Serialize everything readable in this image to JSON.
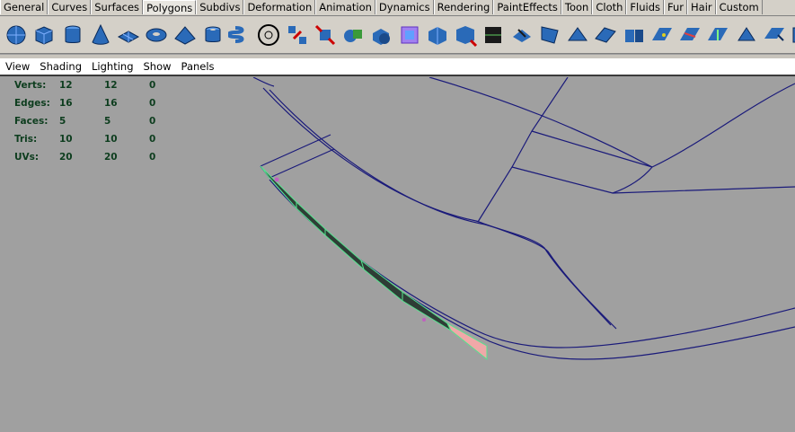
{
  "shelf_tabs": [
    "General",
    "Curves",
    "Surfaces",
    "Polygons",
    "Subdivs",
    "Deformation",
    "Animation",
    "Dynamics",
    "Rendering",
    "PaintEffects",
    "Toon",
    "Cloth",
    "Fluids",
    "Fur",
    "Hair",
    "Custom"
  ],
  "active_tab": "Polygons",
  "shelf_tools": [
    "poly-sphere-icon",
    "poly-cube-icon",
    "poly-cylinder-icon",
    "poly-cone-icon",
    "poly-plane-icon",
    "poly-torus-icon",
    "poly-pyramid-icon",
    "poly-pipe-icon",
    "poly-helix-icon",
    "poly-soccer-ball-icon",
    "separate-icon",
    "combine-icon",
    "boolean-icon",
    "smooth-icon",
    "subdiv-proxy-icon",
    "extrude-face-icon",
    "extrude-edge-icon",
    "split-polygon-icon",
    "bevel-icon",
    "merge-icon",
    "wedge-icon",
    "bridge-icon",
    "append-icon",
    "cut-faces-icon",
    "split-edge-ring-icon",
    "insert-edgeloop-icon",
    "collapse-icon",
    "fill-hole-icon",
    "duplicate-face-icon"
  ],
  "panel_menu": [
    "View",
    "Shading",
    "Lighting",
    "Show",
    "Panels"
  ],
  "hud": {
    "rows": [
      {
        "label": "Verts:",
        "v1": "12",
        "v2": "12",
        "v3": "0"
      },
      {
        "label": "Edges:",
        "v1": "16",
        "v2": "16",
        "v3": "0"
      },
      {
        "label": "Faces:",
        "v1": "5",
        "v2": "5",
        "v3": "0"
      },
      {
        "label": "Tris:",
        "v1": "10",
        "v2": "10",
        "v3": "0"
      },
      {
        "label": "UVs:",
        "v1": "20",
        "v2": "20",
        "v3": "0"
      }
    ]
  },
  "colors": {
    "shelf_bg": "#d4d0c8",
    "viewport_bg": "#a0a0a0",
    "wire": "#1a1a7a",
    "selected_face": "#2e3d36",
    "highlight_edge": "#55e38e",
    "selected_tip": "#f0a8a8",
    "hud_text": "#0d3d1e"
  }
}
